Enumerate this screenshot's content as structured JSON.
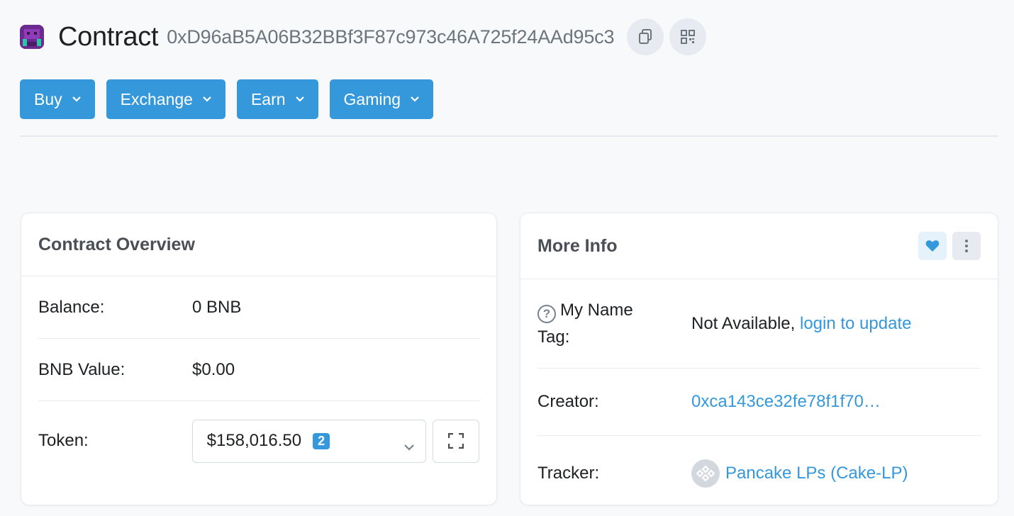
{
  "header": {
    "title": "Contract",
    "address": "0xD96aB5A06B32BBf3F87c973c46A725f24AAd95c3",
    "copy_icon": "copy-icon",
    "qr_icon": "qr-code-icon"
  },
  "nav": {
    "buttons": [
      {
        "label": "Buy"
      },
      {
        "label": "Exchange"
      },
      {
        "label": "Earn"
      },
      {
        "label": "Gaming"
      }
    ]
  },
  "overview": {
    "title": "Contract Overview",
    "rows": [
      {
        "label": "Balance:",
        "value": "0 BNB"
      },
      {
        "label": "BNB Value:",
        "value": "$0.00"
      },
      {
        "label": "Token:",
        "value": "$158,016.50",
        "badge": "2"
      }
    ]
  },
  "more_info": {
    "title": "More Info",
    "name_tag_label_1": "My Name",
    "name_tag_label_2": "Tag:",
    "name_tag_value": "Not Available,",
    "name_tag_link": "login to update",
    "creator_label": "Creator:",
    "creator_value": "0xca143ce32fe78f1f70…",
    "tracker_label": "Tracker:",
    "tracker_value": "Pancake LPs (Cake-LP)"
  },
  "colors": {
    "accent": "#3498db",
    "background": "#f8f9fa",
    "text": "#1e2022",
    "muted": "#6c757e"
  }
}
